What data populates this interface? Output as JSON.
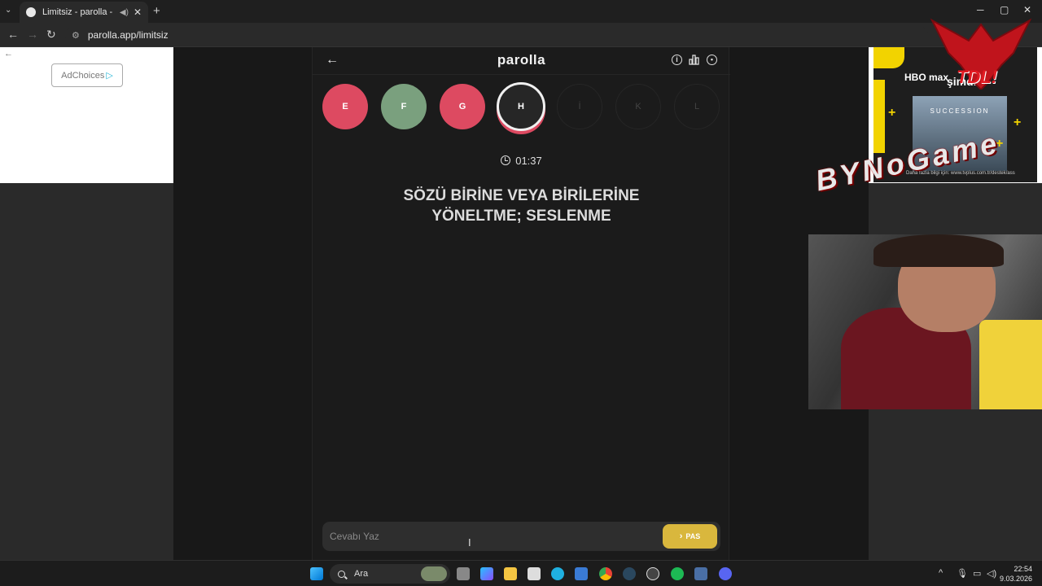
{
  "browser": {
    "tab_title": "Limitsiz - parolla - Kelime o",
    "tab_dropdown": "⌄",
    "new_tab": "+",
    "url": "parolla.app/limitsiz",
    "window_controls": {
      "minimize": "─",
      "maximize": "▢",
      "close": "✕"
    },
    "nav": {
      "back": "←",
      "forward": "→",
      "reload": "↻"
    }
  },
  "left_ad": {
    "back": "←",
    "adchoices": "AdChoices",
    "adchoices_icon": "▷"
  },
  "game": {
    "logo": "parolla",
    "back_icon": "←",
    "header_icons": [
      "info-icon",
      "stats-icon",
      "profile-icon"
    ],
    "letters": [
      {
        "letter": "E",
        "state": "wrong"
      },
      {
        "letter": "F",
        "state": "correct"
      },
      {
        "letter": "G",
        "state": "wrong"
      },
      {
        "letter": "H",
        "state": "current"
      },
      {
        "letter": "İ",
        "state": "todo"
      },
      {
        "letter": "K",
        "state": "todo"
      },
      {
        "letter": "L",
        "state": "todo"
      }
    ],
    "timer": "01:37",
    "question_line1": "SÖZÜ BİRİNE VEYA BİRİLERİNE",
    "question_line2": "YÖNELTME; SESLENME",
    "answer_placeholder": "Cevabı Yaz",
    "pass_label": "PAS",
    "pass_icon": "›"
  },
  "colors": {
    "wrong": "#dd4a61",
    "correct": "#7aa07e",
    "pass": "#d9b73d"
  },
  "right_ad": {
    "hbo": "HBO max",
    "simdi": "şimdi",
    "poster_title": "SUCCESSION",
    "small_text": "Daha fazla bilgi için: www.tvplus.com.tr/destek/ass",
    "plus": "+"
  },
  "overlay": {
    "tdl": "TDL!",
    "bynogame": "BYNoGame"
  },
  "taskbar": {
    "search_label": "Ara",
    "time": "22:54",
    "date": "9.03.2026"
  }
}
